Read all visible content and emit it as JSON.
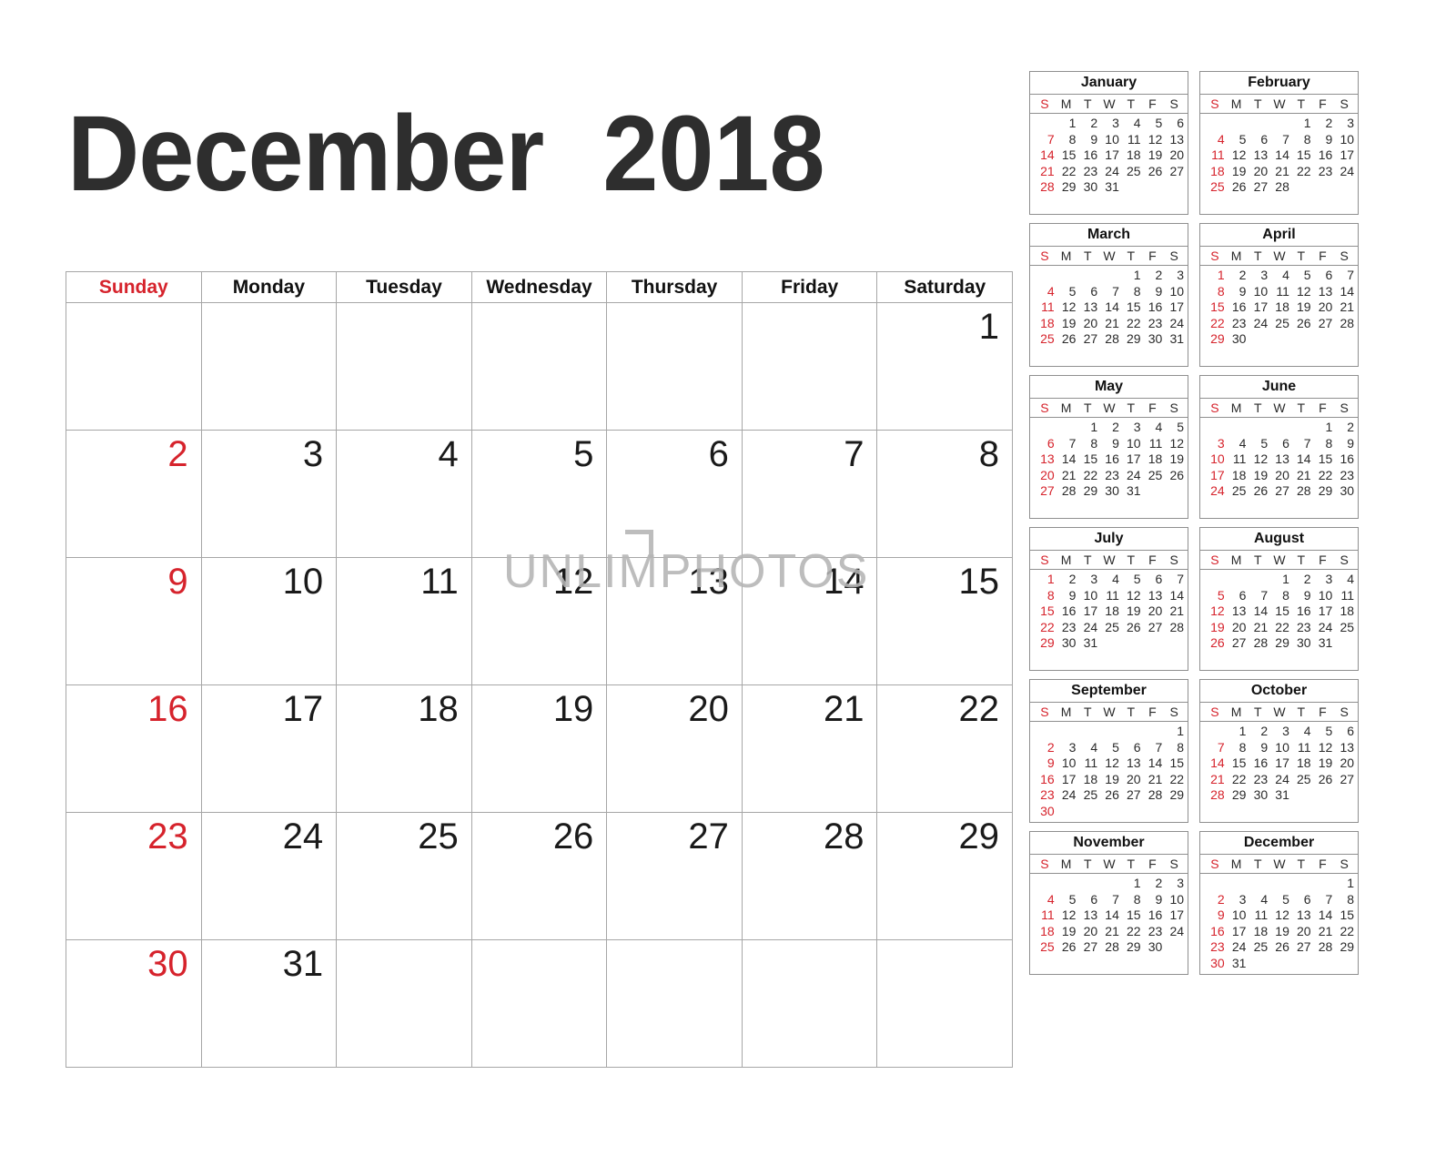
{
  "title": {
    "month": "December",
    "year": "2018"
  },
  "colors": {
    "sunday_red": "#d6232c",
    "text_dark": "#2e2e2e",
    "grid_line": "#a6a6a6",
    "mini_border": "#8f8f8f",
    "watermark": "#b5b5b5"
  },
  "watermark": {
    "text": "UNLIMPHOTOS"
  },
  "main_calendar": {
    "weekday_headers": [
      "Sunday",
      "Monday",
      "Tuesday",
      "Wednesday",
      "Thursday",
      "Friday",
      "Saturday"
    ],
    "weeks": [
      [
        "",
        "",
        "",
        "",
        "",
        "",
        "1"
      ],
      [
        "2",
        "3",
        "4",
        "5",
        "6",
        "7",
        "8"
      ],
      [
        "9",
        "10",
        "11",
        "12",
        "13",
        "14",
        "15"
      ],
      [
        "16",
        "17",
        "18",
        "19",
        "20",
        "21",
        "22"
      ],
      [
        "23",
        "24",
        "25",
        "26",
        "27",
        "28",
        "29"
      ],
      [
        "30",
        "31",
        "",
        "",
        "",
        "",
        ""
      ]
    ]
  },
  "mini_calendars": {
    "dow_labels": [
      "S",
      "M",
      "T",
      "W",
      "T",
      "F",
      "S"
    ],
    "months": [
      {
        "name": "January",
        "weeks": [
          [
            "",
            "1",
            "2",
            "3",
            "4",
            "5",
            "6"
          ],
          [
            "7",
            "8",
            "9",
            "10",
            "11",
            "12",
            "13"
          ],
          [
            "14",
            "15",
            "16",
            "17",
            "18",
            "19",
            "20"
          ],
          [
            "21",
            "22",
            "23",
            "24",
            "25",
            "26",
            "27"
          ],
          [
            "28",
            "29",
            "30",
            "31",
            "",
            "",
            ""
          ]
        ]
      },
      {
        "name": "February",
        "weeks": [
          [
            "",
            "",
            "",
            "",
            "1",
            "2",
            "3"
          ],
          [
            "4",
            "5",
            "6",
            "7",
            "8",
            "9",
            "10"
          ],
          [
            "11",
            "12",
            "13",
            "14",
            "15",
            "16",
            "17"
          ],
          [
            "18",
            "19",
            "20",
            "21",
            "22",
            "23",
            "24"
          ],
          [
            "25",
            "26",
            "27",
            "28",
            "",
            "",
            ""
          ]
        ]
      },
      {
        "name": "March",
        "weeks": [
          [
            "",
            "",
            "",
            "",
            "1",
            "2",
            "3"
          ],
          [
            "4",
            "5",
            "6",
            "7",
            "8",
            "9",
            "10"
          ],
          [
            "11",
            "12",
            "13",
            "14",
            "15",
            "16",
            "17"
          ],
          [
            "18",
            "19",
            "20",
            "21",
            "22",
            "23",
            "24"
          ],
          [
            "25",
            "26",
            "27",
            "28",
            "29",
            "30",
            "31"
          ]
        ]
      },
      {
        "name": "April",
        "weeks": [
          [
            "1",
            "2",
            "3",
            "4",
            "5",
            "6",
            "7"
          ],
          [
            "8",
            "9",
            "10",
            "11",
            "12",
            "13",
            "14"
          ],
          [
            "15",
            "16",
            "17",
            "18",
            "19",
            "20",
            "21"
          ],
          [
            "22",
            "23",
            "24",
            "25",
            "26",
            "27",
            "28"
          ],
          [
            "29",
            "30",
            "",
            "",
            "",
            "",
            ""
          ]
        ]
      },
      {
        "name": "May",
        "weeks": [
          [
            "",
            "",
            "1",
            "2",
            "3",
            "4",
            "5"
          ],
          [
            "6",
            "7",
            "8",
            "9",
            "10",
            "11",
            "12"
          ],
          [
            "13",
            "14",
            "15",
            "16",
            "17",
            "18",
            "19"
          ],
          [
            "20",
            "21",
            "22",
            "23",
            "24",
            "25",
            "26"
          ],
          [
            "27",
            "28",
            "29",
            "30",
            "31",
            "",
            ""
          ]
        ]
      },
      {
        "name": "June",
        "weeks": [
          [
            "",
            "",
            "",
            "",
            "",
            "1",
            "2"
          ],
          [
            "3",
            "4",
            "5",
            "6",
            "7",
            "8",
            "9"
          ],
          [
            "10",
            "11",
            "12",
            "13",
            "14",
            "15",
            "16"
          ],
          [
            "17",
            "18",
            "19",
            "20",
            "21",
            "22",
            "23"
          ],
          [
            "24",
            "25",
            "26",
            "27",
            "28",
            "29",
            "30"
          ]
        ]
      },
      {
        "name": "July",
        "weeks": [
          [
            "1",
            "2",
            "3",
            "4",
            "5",
            "6",
            "7"
          ],
          [
            "8",
            "9",
            "10",
            "11",
            "12",
            "13",
            "14"
          ],
          [
            "15",
            "16",
            "17",
            "18",
            "19",
            "20",
            "21"
          ],
          [
            "22",
            "23",
            "24",
            "25",
            "26",
            "27",
            "28"
          ],
          [
            "29",
            "30",
            "31",
            "",
            "",
            "",
            ""
          ]
        ]
      },
      {
        "name": "August",
        "weeks": [
          [
            "",
            "",
            "",
            "1",
            "2",
            "3",
            "4"
          ],
          [
            "5",
            "6",
            "7",
            "8",
            "9",
            "10",
            "11"
          ],
          [
            "12",
            "13",
            "14",
            "15",
            "16",
            "17",
            "18"
          ],
          [
            "19",
            "20",
            "21",
            "22",
            "23",
            "24",
            "25"
          ],
          [
            "26",
            "27",
            "28",
            "29",
            "30",
            "31",
            ""
          ]
        ]
      },
      {
        "name": "September",
        "weeks": [
          [
            "",
            "",
            "",
            "",
            "",
            "",
            "1"
          ],
          [
            "2",
            "3",
            "4",
            "5",
            "6",
            "7",
            "8"
          ],
          [
            "9",
            "10",
            "11",
            "12",
            "13",
            "14",
            "15"
          ],
          [
            "16",
            "17",
            "18",
            "19",
            "20",
            "21",
            "22"
          ],
          [
            "23",
            "24",
            "25",
            "26",
            "27",
            "28",
            "29"
          ],
          [
            "30",
            "",
            "",
            "",
            "",
            "",
            ""
          ]
        ]
      },
      {
        "name": "October",
        "weeks": [
          [
            "",
            "1",
            "2",
            "3",
            "4",
            "5",
            "6"
          ],
          [
            "7",
            "8",
            "9",
            "10",
            "11",
            "12",
            "13"
          ],
          [
            "14",
            "15",
            "16",
            "17",
            "18",
            "19",
            "20"
          ],
          [
            "21",
            "22",
            "23",
            "24",
            "25",
            "26",
            "27"
          ],
          [
            "28",
            "29",
            "30",
            "31",
            "",
            "",
            ""
          ]
        ]
      },
      {
        "name": "November",
        "weeks": [
          [
            "",
            "",
            "",
            "",
            "1",
            "2",
            "3"
          ],
          [
            "4",
            "5",
            "6",
            "7",
            "8",
            "9",
            "10"
          ],
          [
            "11",
            "12",
            "13",
            "14",
            "15",
            "16",
            "17"
          ],
          [
            "18",
            "19",
            "20",
            "21",
            "22",
            "23",
            "24"
          ],
          [
            "25",
            "26",
            "27",
            "28",
            "29",
            "30",
            ""
          ]
        ]
      },
      {
        "name": "December",
        "weeks": [
          [
            "",
            "",
            "",
            "",
            "",
            "",
            "1"
          ],
          [
            "2",
            "3",
            "4",
            "5",
            "6",
            "7",
            "8"
          ],
          [
            "9",
            "10",
            "11",
            "12",
            "13",
            "14",
            "15"
          ],
          [
            "16",
            "17",
            "18",
            "19",
            "20",
            "21",
            "22"
          ],
          [
            "23",
            "24",
            "25",
            "26",
            "27",
            "28",
            "29"
          ],
          [
            "30",
            "31",
            "",
            "",
            "",
            "",
            ""
          ]
        ]
      }
    ]
  }
}
